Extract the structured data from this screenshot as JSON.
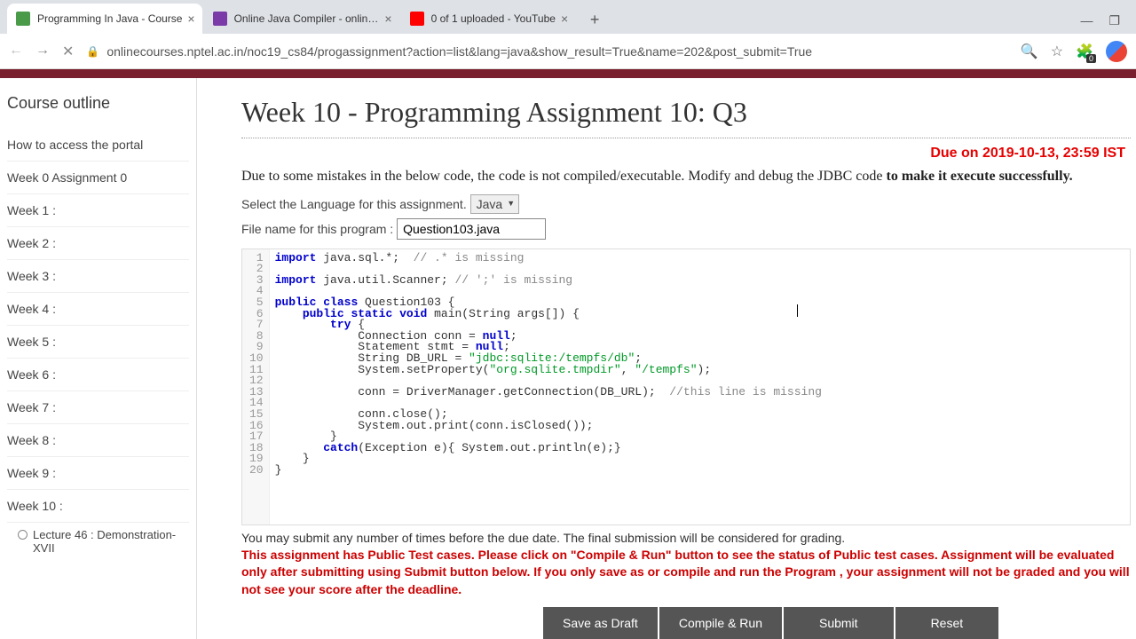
{
  "tabs": [
    {
      "title": "Programming In Java - Course",
      "active": true
    },
    {
      "title": "Online Java Compiler - online ed",
      "active": false
    },
    {
      "title": "0 of 1 uploaded - YouTube",
      "active": false
    }
  ],
  "url": "onlinecourses.nptel.ac.in/noc19_cs84/progassignment?action=list&lang=java&show_result=True&name=202&post_submit=True",
  "sidebar": {
    "title": "Course outline",
    "items": [
      "How to access the portal",
      "Week 0 Assignment 0",
      "Week 1 :",
      "Week 2 :",
      "Week 3 :",
      "Week 4 :",
      "Week 5 :",
      "Week 6 :",
      "Week 7 :",
      "Week 8 :",
      "Week 9 :",
      "Week 10 :"
    ],
    "subitem": "Lecture 46 : Demonstration-XVII"
  },
  "main": {
    "title": "Week 10 - Programming Assignment 10: Q3",
    "due": "Due on 2019-10-13, 23:59 IST",
    "instr1": "Due to some mistakes in the below code, the code is not compiled/executable. Modify and debug the JDBC code ",
    "instr2": "to make it execute successfully.",
    "lang_label": "Select the Language for this assignment.",
    "lang_value": "Java",
    "file_label": "File name for this program :",
    "file_value": "Question103.java",
    "submit_note": "You may submit any number of times before the due date. The final submission will be considered for grading.",
    "test_warning": "This assignment has Public Test cases. Please click on \"Compile & Run\" button to see the status of Public test cases. Assignment will be evaluated only after submitting using Submit button below. If you only save as or compile and run the Program , your assignment will not be graded and you will not see your score after the deadline.",
    "buttons": {
      "draft": "Save as Draft",
      "compile": "Compile & Run",
      "submit": "Submit",
      "reset": "Reset"
    }
  },
  "code": {
    "line_count": 20,
    "lines_html": [
      "<span class='kw'>import</span> java.sql.*;  <span class='cmt'>// .* is missing</span>",
      "",
      "<span class='kw'>import</span> java.util.Scanner; <span class='cmt'>// ';' is missing</span>",
      "",
      "<span class='kw'>public</span> <span class='kw'>class</span> Question103 {",
      "    <span class='kw'>public</span> <span class='kw'>static</span> <span class='kw'>void</span> main(String args[]) {",
      "        <span class='kw'>try</span> {",
      "            Connection conn = <span class='kw'>null</span>;",
      "            Statement stmt = <span class='kw'>null</span>;",
      "            String DB_URL = <span class='str'>\"jdbc:sqlite:/tempfs/db\"</span>;",
      "            System.setProperty(<span class='str'>\"org.sqlite.tmpdir\"</span>, <span class='str'>\"/tempfs\"</span>);",
      "",
      "            conn = DriverManager.getConnection(DB_URL);  <span class='cmt'>//this line is missing</span>",
      "",
      "            conn.close();",
      "            System.out.print(conn.isClosed());",
      "        }",
      "       <span class='kw'>catch</span>(Exception e){ System.out.println(e);}",
      "    }",
      "}"
    ]
  }
}
